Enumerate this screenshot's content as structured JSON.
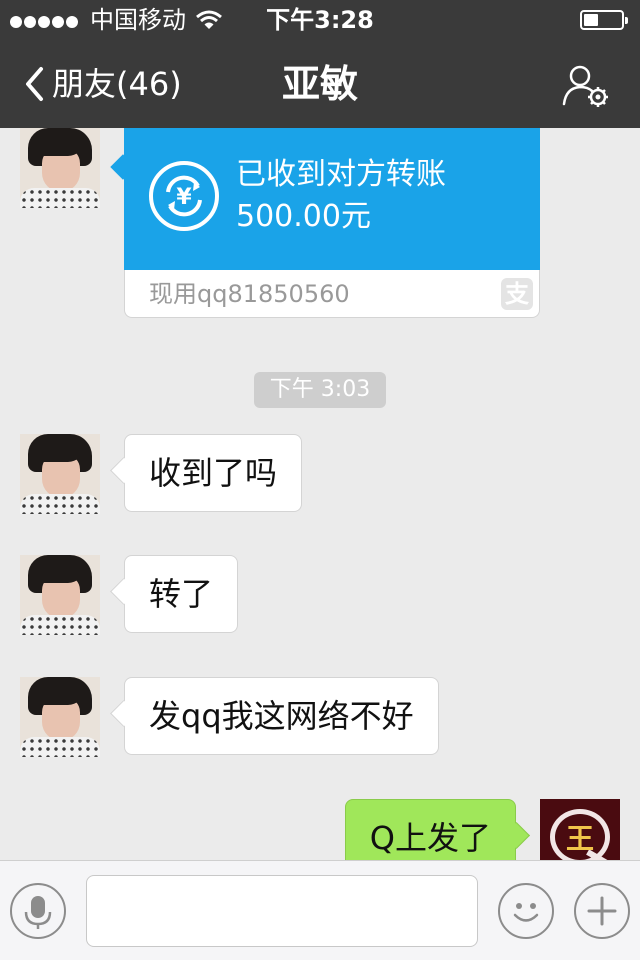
{
  "status_bar": {
    "carrier": "中国移动",
    "time": "下午3:28"
  },
  "nav": {
    "back_label": "朋友(46)",
    "title": "亚敏",
    "profile_icon": "user-settings-icon"
  },
  "transfer": {
    "title": "已收到对方转账",
    "amount": "500.00元",
    "source": "现用qq81850560",
    "brand_glyph": "支",
    "colors": {
      "card": "#1aa3e8"
    }
  },
  "time_divider": "下午 3:03",
  "messages": [
    {
      "sender": "亚敏",
      "text": "收到了吗"
    },
    {
      "sender": "亚敏",
      "text": "转了"
    },
    {
      "sender": "亚敏",
      "text": "发qq我这网络不好"
    },
    {
      "sender": "me",
      "text": "Q上发了"
    }
  ],
  "my_avatar_glyph": "王",
  "input": {
    "value": "",
    "placeholder": ""
  },
  "colors": {
    "bar": "#3a3a3a",
    "background": "#ebebeb",
    "my_bubble": "#a0e75a"
  }
}
